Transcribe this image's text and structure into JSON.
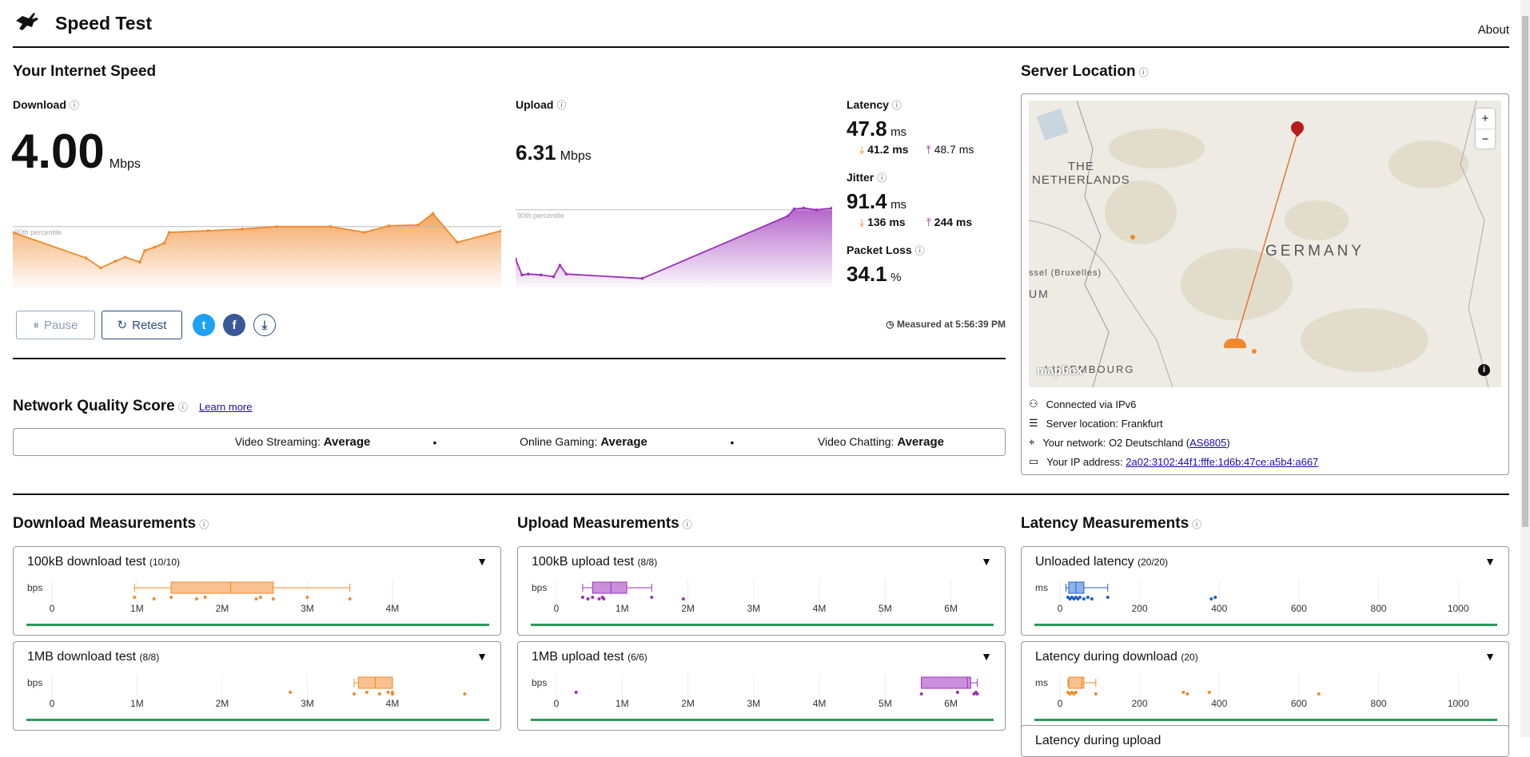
{
  "header": {
    "title": "Speed Test",
    "about": "About"
  },
  "speed": {
    "title": "Your Internet Speed",
    "download": {
      "label": "Download",
      "value": "4.00",
      "unit": "Mbps"
    },
    "upload": {
      "label": "Upload",
      "value": "6.31",
      "unit": "Mbps"
    },
    "latency": {
      "label": "Latency",
      "value": "47.8",
      "unit": "ms",
      "down": "41.2 ms",
      "up": "48.7 ms"
    },
    "jitter": {
      "label": "Jitter",
      "value": "91.4",
      "unit": "ms",
      "down": "136 ms",
      "up": "244 ms"
    },
    "packet_loss": {
      "label": "Packet Loss",
      "value": "34.1",
      "unit": "%"
    },
    "percentile_label": "90th percentile",
    "pause": "Pause",
    "retest": "Retest",
    "measured": "Measured at 5:56:39 PM"
  },
  "quality": {
    "title": "Network Quality Score",
    "learn_more": "Learn more",
    "items": [
      {
        "label": "Video Streaming:",
        "value": "Average"
      },
      {
        "label": "Online Gaming:",
        "value": "Average"
      },
      {
        "label": "Video Chatting:",
        "value": "Average"
      }
    ]
  },
  "server": {
    "title": "Server Location",
    "map_labels": {
      "nl": "THE\nNETHERLANDS",
      "de": "GERMANY",
      "lu": "LUXEMBOURG",
      "be": "ssel (Bruxelles)",
      "um": "UM",
      "logo": "mapbox"
    },
    "connected": "Connected via IPv6",
    "location": "Server location: Frankfurt",
    "network_prefix": "Your network: O2 Deutschland (",
    "network_as": "AS6805",
    "network_suffix": ")",
    "ip_prefix": "Your IP address: ",
    "ip": "2a02:3102:44f1:fffe:1d6b:47ce:a5b4:a667"
  },
  "measurements": {
    "download_title": "Download Measurements",
    "upload_title": "Upload Measurements",
    "latency_title": "Latency Measurements",
    "partial_card": "Latency during upload"
  },
  "colors": {
    "download": "#f0892b",
    "upload": "#9b30b8",
    "latency": "#1a62c9",
    "green": "#2e9b57"
  },
  "chart_data": [
    {
      "type": "area",
      "name": "download-sparkline",
      "unit": "Mbps",
      "p90": 4.62,
      "ymax": 6.3,
      "x": [
        0,
        15,
        18,
        21,
        23,
        26,
        27,
        29,
        31,
        32,
        40,
        47,
        54,
        65,
        72,
        77,
        83,
        86,
        91,
        100
      ],
      "y": [
        4.13,
        1.96,
        1.12,
        1.68,
        2.03,
        1.61,
        2.59,
        2.87,
        3.22,
        4.13,
        4.27,
        4.41,
        4.62,
        4.62,
        4.13,
        4.69,
        4.76,
        5.74,
        3.29,
        4.27
      ]
    },
    {
      "type": "area",
      "name": "upload-sparkline",
      "unit": "Mbps",
      "p90": 7.29,
      "ymax": 7.6,
      "x": [
        0,
        2,
        4,
        8,
        12,
        14,
        16,
        40,
        86,
        88,
        91,
        95,
        100
      ],
      "y": [
        2.25,
        0.63,
        0.72,
        0.63,
        0.45,
        1.62,
        0.72,
        0.27,
        6.66,
        7.38,
        7.47,
        7.29,
        7.47
      ]
    },
    {
      "type": "box",
      "title": "100kB download test",
      "count": "(10/10)",
      "unit": "bps",
      "ticks": [
        "0",
        "1M",
        "2M",
        "3M",
        "4M"
      ],
      "tickvals": [
        0,
        1,
        2,
        3,
        4
      ],
      "xmax": 5.1,
      "color": "#f0892b",
      "fill": "#f9c190",
      "whisker": [
        0.97,
        3.5
      ],
      "box": [
        1.4,
        2.6
      ],
      "median": 2.1,
      "points": [
        0.97,
        1.2,
        1.4,
        1.7,
        1.8,
        2.4,
        2.45,
        2.6,
        3.0,
        3.5
      ]
    },
    {
      "type": "box",
      "title": "1MB download test",
      "count": "(8/8)",
      "unit": "bps",
      "ticks": [
        "0",
        "1M",
        "2M",
        "3M",
        "4M"
      ],
      "tickvals": [
        0,
        1,
        2,
        3,
        4
      ],
      "xmax": 5.1,
      "color": "#f0892b",
      "fill": "#f9c190",
      "whisker": [
        3.55,
        4.0
      ],
      "box": [
        3.6,
        4.0
      ],
      "median": 3.8,
      "points": [
        2.8,
        3.55,
        3.7,
        3.85,
        3.95,
        4.0,
        4.0,
        4.85
      ]
    },
    {
      "type": "box",
      "title": "100kB upload test",
      "count": "(8/8)",
      "unit": "bps",
      "ticks": [
        "0",
        "1M",
        "2M",
        "3M",
        "4M",
        "5M",
        "6M"
      ],
      "tickvals": [
        0,
        1,
        2,
        3,
        4,
        5,
        6
      ],
      "xmax": 6.6,
      "color": "#9b30b8",
      "fill": "#cc8fdc",
      "whisker": [
        0.4,
        1.45
      ],
      "box": [
        0.55,
        1.07
      ],
      "median": 0.83,
      "points": [
        0.4,
        0.48,
        0.55,
        0.65,
        0.7,
        0.72,
        1.45,
        1.93
      ]
    },
    {
      "type": "box",
      "title": "1MB upload test",
      "count": "(6/6)",
      "unit": "bps",
      "ticks": [
        "0",
        "1M",
        "2M",
        "3M",
        "4M",
        "5M",
        "6M"
      ],
      "tickvals": [
        0,
        1,
        2,
        3,
        4,
        5,
        6
      ],
      "xmax": 6.6,
      "color": "#9b30b8",
      "fill": "#cc8fdc",
      "whisker": [
        5.55,
        6.4
      ],
      "box": [
        5.55,
        6.3
      ],
      "median": 6.25,
      "points": [
        0.3,
        5.55,
        6.1,
        6.35,
        6.38,
        6.4
      ]
    },
    {
      "type": "box",
      "title": "Unloaded latency",
      "count": "(20/20)",
      "unit": "ms",
      "ticks": [
        "0",
        "200",
        "400",
        "600",
        "800",
        "1000"
      ],
      "tickvals": [
        0,
        200,
        400,
        600,
        800,
        1000
      ],
      "xmax": 1090,
      "color": "#1a62c9",
      "fill": "#8fb3e8",
      "whisker": [
        15,
        120
      ],
      "box": [
        22,
        60
      ],
      "median": 40,
      "points": [
        20,
        25,
        30,
        35,
        40,
        45,
        50,
        60,
        70,
        80,
        120,
        380,
        390
      ]
    },
    {
      "type": "box",
      "title": "Latency during download",
      "count": "(20)",
      "unit": "ms",
      "ticks": [
        "0",
        "200",
        "400",
        "600",
        "800",
        "1000"
      ],
      "tickvals": [
        0,
        200,
        400,
        600,
        800,
        1000
      ],
      "xmax": 1090,
      "color": "#f0892b",
      "fill": "#f9c190",
      "whisker": [
        20,
        90
      ],
      "box": [
        22,
        60
      ],
      "median": 55,
      "points": [
        20,
        25,
        30,
        35,
        40,
        90,
        310,
        320,
        375,
        650
      ]
    }
  ]
}
